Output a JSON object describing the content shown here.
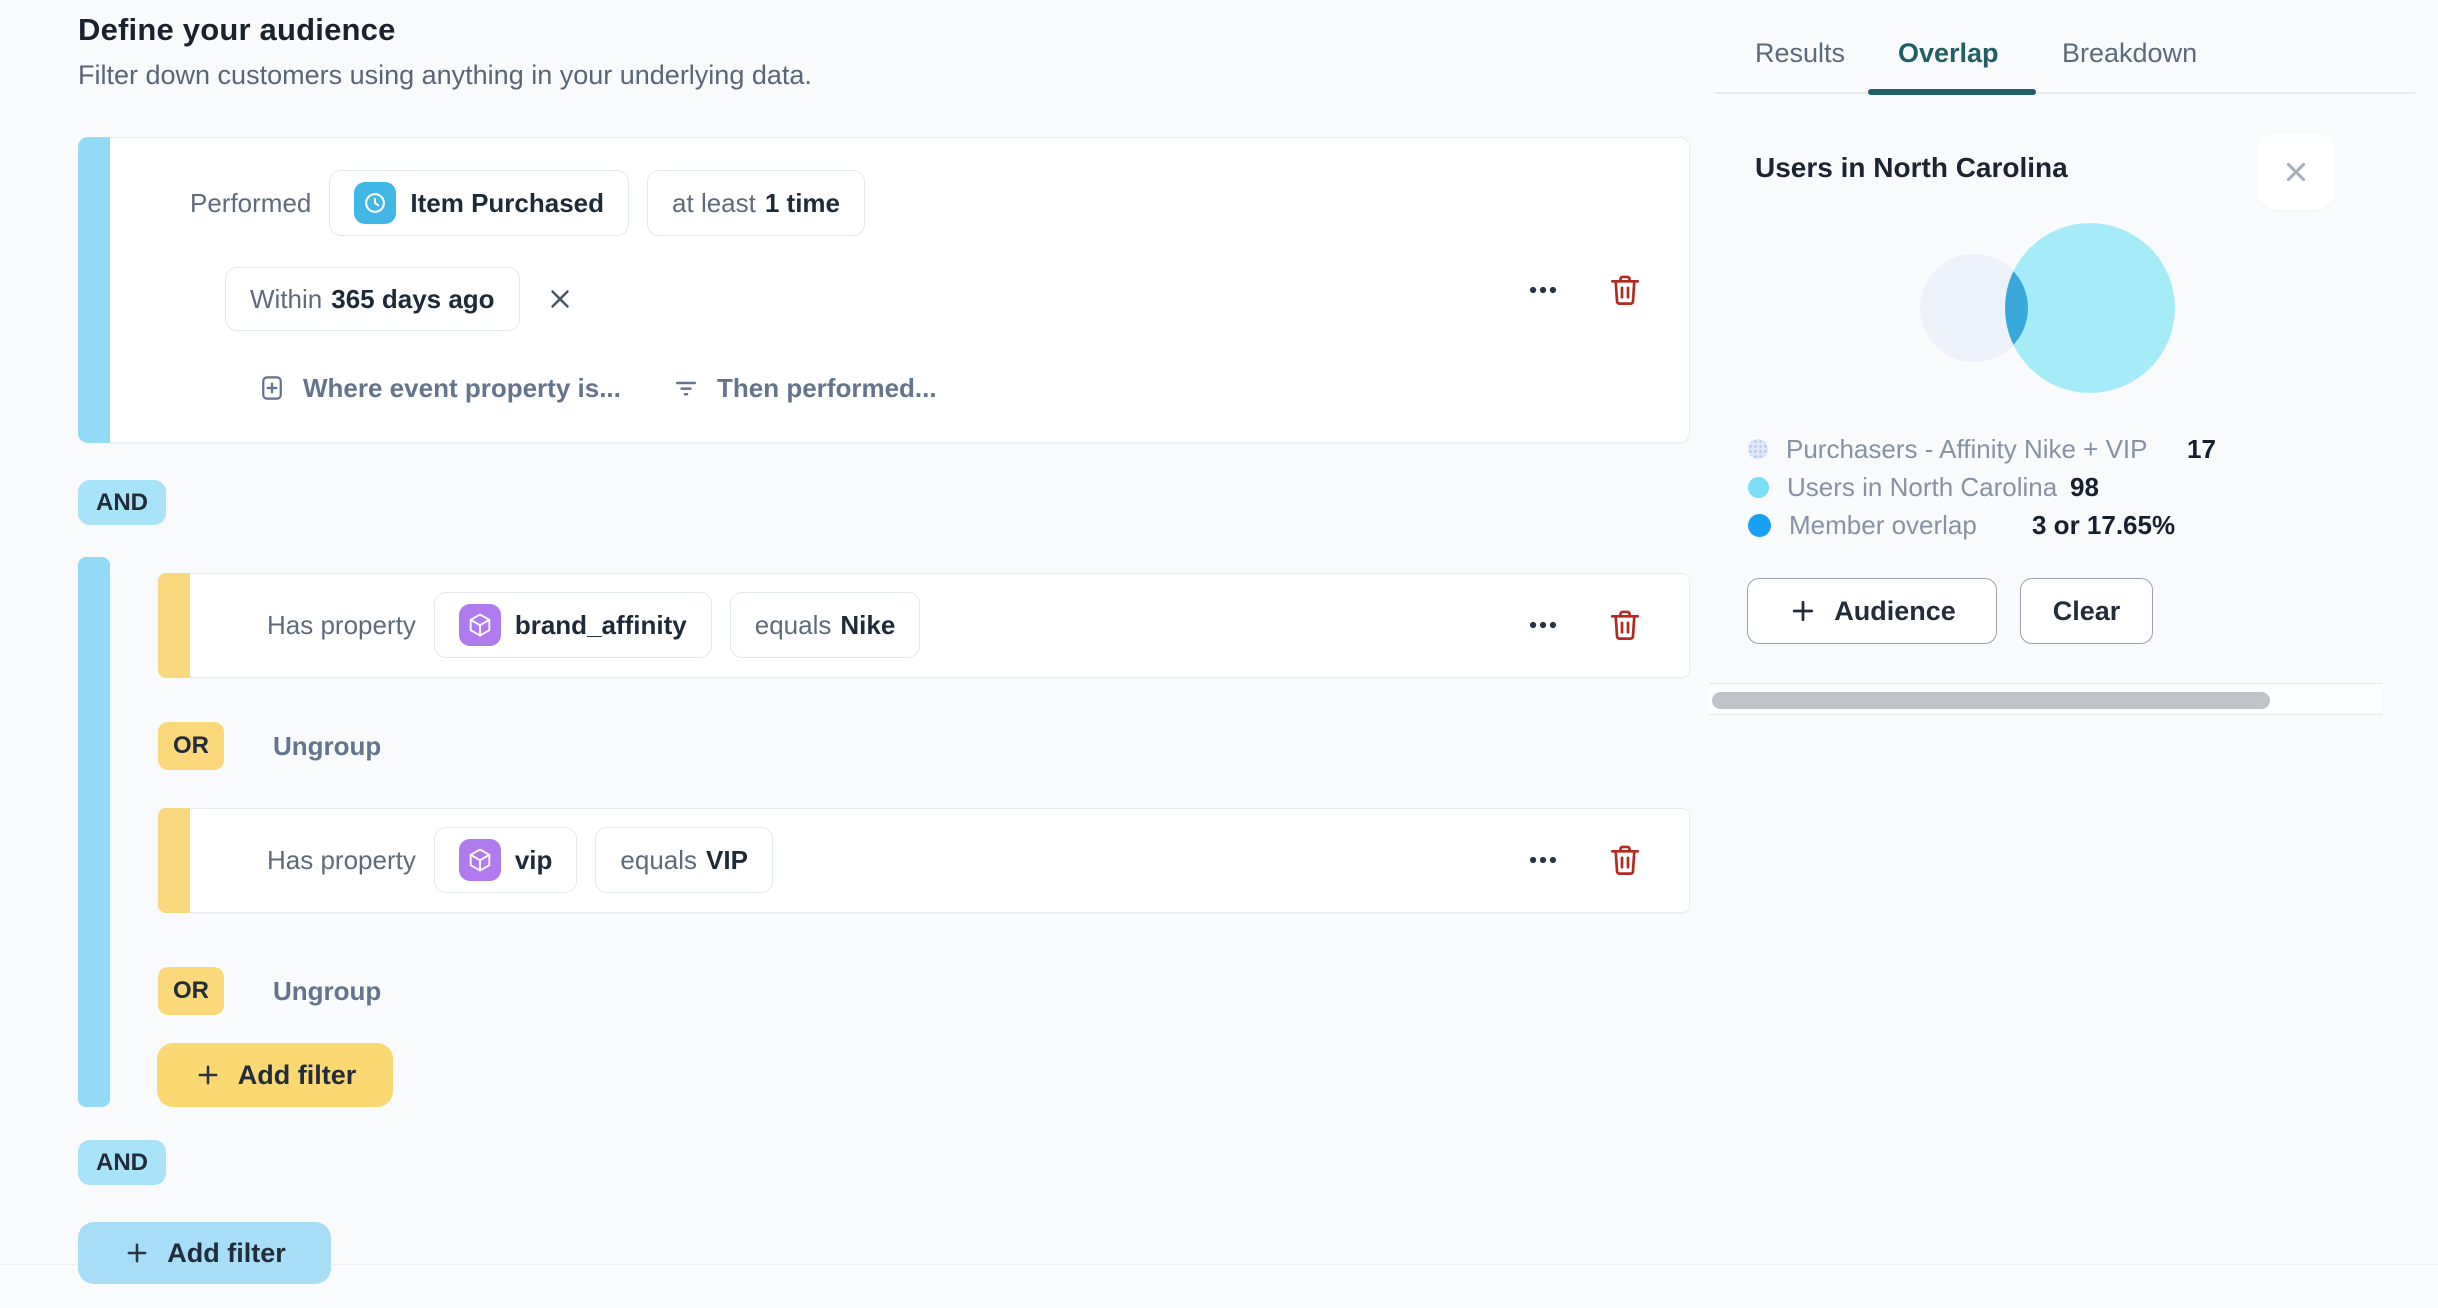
{
  "header": {
    "title": "Define your audience",
    "subtitle": "Filter down customers using anything in your underlying data."
  },
  "labels": {
    "and": "AND",
    "or": "OR",
    "ungroup": "Ungroup",
    "add_filter": "Add filter"
  },
  "event_card": {
    "performed_label": "Performed",
    "event_name": "Item Purchased",
    "count_prefix": "at least",
    "count_value": "1 time",
    "within_prefix": "Within",
    "within_value": "365 days ago",
    "where_event_property_link": "Where event property is...",
    "then_performed_link": "Then performed..."
  },
  "property_rows": [
    {
      "label": "Has property",
      "property": "brand_affinity",
      "operator": "equals",
      "value": "Nike"
    },
    {
      "label": "Has property",
      "property": "vip",
      "operator": "equals",
      "value": "VIP"
    }
  ],
  "panel": {
    "tabs": [
      {
        "label": "Results",
        "active": false
      },
      {
        "label": "Overlap",
        "active": true
      },
      {
        "label": "Breakdown",
        "active": false
      }
    ],
    "title": "Users in North Carolina",
    "venn": {
      "left_color": "#EDF1FA",
      "right_color": "#A6ECF8",
      "overlap_color": "#38A9DA"
    },
    "legend": [
      {
        "label": "Purchasers - Affinity Nike + VIP",
        "value": "17",
        "color": "#DDE7F9"
      },
      {
        "label": "Users in North Carolina",
        "value": "98",
        "color": "#7BDDF6"
      },
      {
        "label": "Member overlap",
        "value": "3 or 17.65%",
        "color": "#18A0F6"
      }
    ],
    "audience_button": "Audience",
    "clear_button": "Clear"
  },
  "icons": {
    "event-icon": "clock",
    "property-icon": "cube",
    "more-icon": "ellipsis",
    "delete-icon": "trash",
    "dismiss-icon": "x",
    "close-icon": "x",
    "add-icon": "plus",
    "where-icon": "plus-square",
    "then-icon": "filter-lines"
  },
  "colors": {
    "and_badge": "#A9E3F8",
    "or_badge": "#FBD97B",
    "blue_bar": "#92DAF6",
    "yellow_bar": "#FAD97E",
    "add_filter_yellow": "#FBD871",
    "add_filter_blue": "#A7DEF6",
    "event_icon_bg": "#41B7E5",
    "property_icon_bg": "#AF7BEF",
    "active_tab": "#215F66",
    "delete_icon": "#B32A21"
  }
}
